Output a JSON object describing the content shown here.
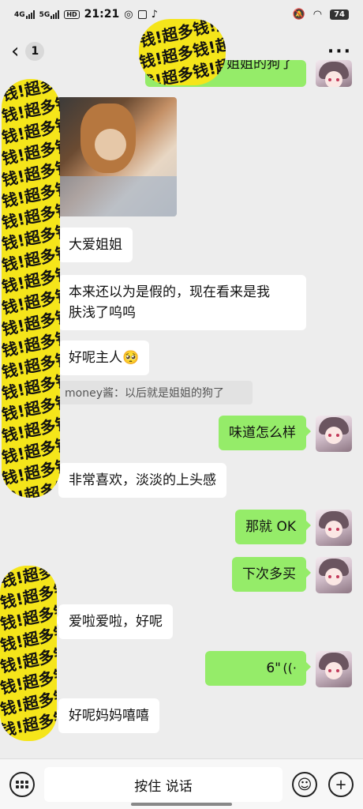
{
  "status_bar": {
    "network_1": "4G",
    "network_2": "5G",
    "hd": "HD",
    "time": "21:21",
    "battery": "74"
  },
  "nav": {
    "back_icon": "chevron-left-icon",
    "unread_count": "1",
    "more_icon": "more-dots-icon"
  },
  "top_partial_message": "姐姐的狗了",
  "messages": {
    "m1": "大爱姐姐",
    "m2_line1": "本来还以为是假的，现在看来是我",
    "m2_line2": "肤浅了呜呜",
    "m3": "好呢主人🥺",
    "quote": "money酱：以后就是姐姐的狗了",
    "m4": "味道怎么样",
    "m5": "非常喜欢，淡淡的上头感",
    "m6": "那就 OK",
    "m7": "下次多买",
    "m8": "爱啦爱啦，好呢",
    "voice_duration": "6\"",
    "m9": "好呢妈妈嘻嘻"
  },
  "watermark": {
    "text": "钱!超多钱!超多钱!超多",
    "color": "#f5e51a"
  },
  "input_bar": {
    "hold_to_talk": "按住 说话",
    "voice_keyboard_icon": "keyboard-icon",
    "emoji_icon": "emoji-icon",
    "plus_icon": "plus-icon"
  },
  "colors": {
    "outgoing_bubble": "#95ec69",
    "incoming_bubble": "#ffffff",
    "background": "#ededed"
  }
}
